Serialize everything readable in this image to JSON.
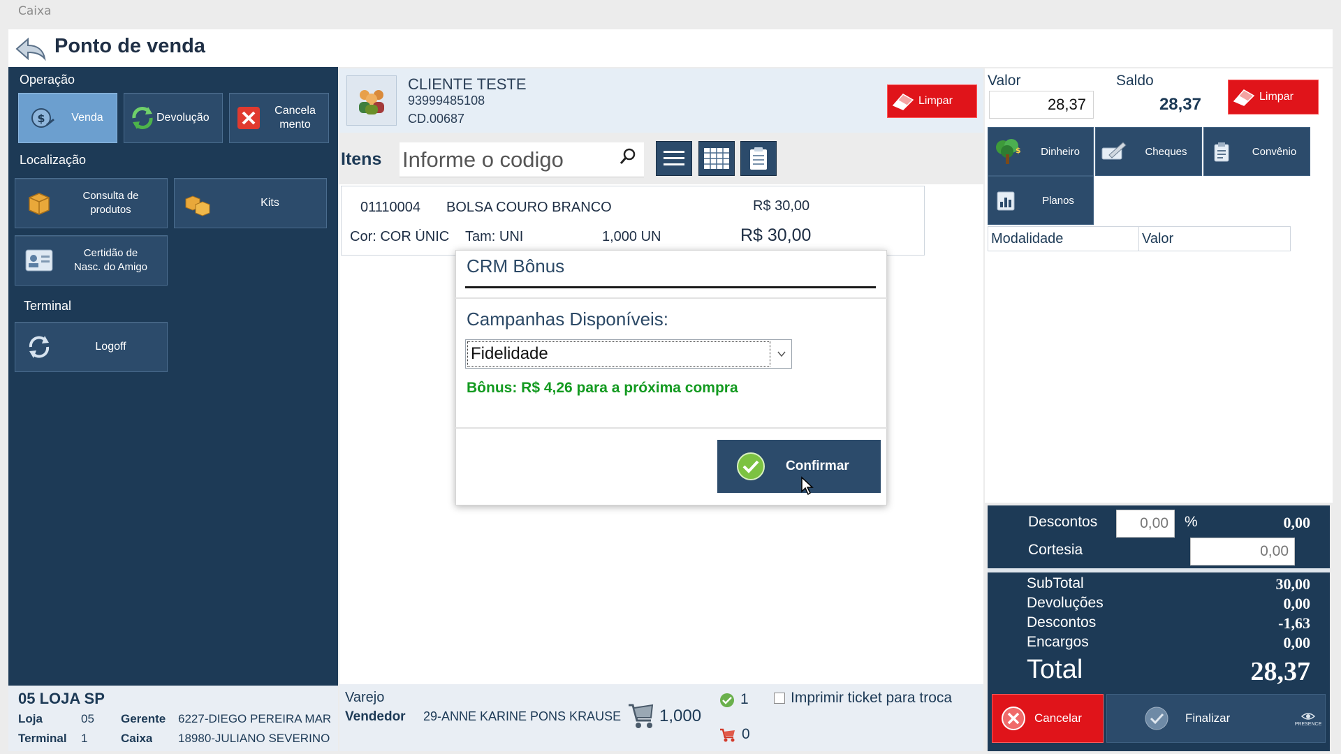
{
  "window": {
    "title": "Caixa"
  },
  "header": {
    "title": "Ponto de venda"
  },
  "sidebar": {
    "operacao_label": "Operação",
    "operacao_buttons": [
      "Venda",
      "Devolução",
      "Cancela\nmento"
    ],
    "localizacao_label": "Localização",
    "localizacao_buttons": [
      "Consulta de\nprodutos",
      "Kits",
      "Certidão de\nNasc. do Amigo"
    ],
    "terminal_label": "Terminal",
    "terminal_buttons": [
      "Logoff"
    ]
  },
  "store": {
    "name": "05 LOJA SP",
    "loja_label": "Loja",
    "loja_value": "05",
    "gerente_label": "Gerente",
    "gerente_value": "6227-DIEGO PEREIRA MAR",
    "terminal_label": "Terminal",
    "terminal_value": "1",
    "caixa_label": "Caixa",
    "caixa_value": "18980-JULIANO SEVERINO"
  },
  "client": {
    "name": "CLIENTE TESTE",
    "phone": "93999485108",
    "code": "CD.00687",
    "clear_label": "Limpar"
  },
  "items": {
    "label": "Itens",
    "search_placeholder": "Informe o codigo",
    "list": [
      {
        "code": "01110004",
        "description": "BOLSA COURO BRANCO",
        "unit_price": "R$ 30,00",
        "color": "Cor: COR ÚNIC",
        "size": "Tam: UNI",
        "quantity": "1,000 UN",
        "total": "R$ 30,00"
      }
    ]
  },
  "dialog": {
    "title": "CRM Bônus",
    "subtitle": "Campanhas Disponíveis:",
    "selected_campaign": "Fidelidade",
    "bonus_text": "Bônus: R$ 4,26 para a próxima compra",
    "confirm_label": "Confirmar"
  },
  "sale_footer": {
    "type": "Varejo",
    "vendedor_label": "Vendedor",
    "vendedor_value": "29-ANNE KARINE PONS KRAUSE",
    "cart_quantity": "1,000",
    "checked_count": "1",
    "cart_count": "0",
    "print_ticket_label": "Imprimir ticket para troca",
    "print_ticket_checked": false
  },
  "payment": {
    "valor_label": "Valor",
    "valor_value": "28,37",
    "saldo_label": "Saldo",
    "saldo_value": "28,37",
    "clear_label": "Limpar",
    "methods": [
      "Dinheiro",
      "Cheques",
      "Convênio",
      "Planos"
    ],
    "table_headers": [
      "Modalidade",
      "Valor"
    ]
  },
  "totals": {
    "descontos_label": "Descontos",
    "descontos_input": "0,00",
    "percent_symbol": "%",
    "descontos_result": "0,00",
    "cortesia_label": "Cortesia",
    "cortesia_input": "0,00",
    "subtotal_label": "SubTotal",
    "subtotal_value": "30,00",
    "devolucoes_label": "Devoluções",
    "devolucoes_value": "0,00",
    "descontos2_label": "Descontos",
    "descontos2_value": "-1,63",
    "encargos_label": "Encargos",
    "encargos_value": "0,00",
    "total_label": "Total",
    "total_value": "28,37",
    "cancel_label": "Cancelar",
    "finalize_label": "Finalizar",
    "logo_text": "PRESENCE"
  },
  "colors": {
    "navy": "#1d3a56",
    "button": "#2c4b6b",
    "active": "#6c9fcf",
    "red": "#e0141a",
    "green": "#139a20"
  }
}
